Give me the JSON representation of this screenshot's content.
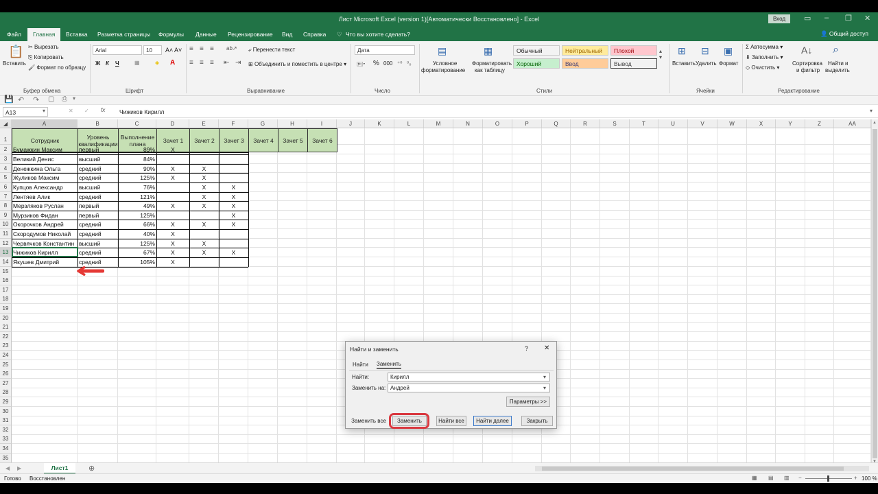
{
  "window": {
    "title": "Лист Microsoft Excel (version 1)[Автоматически Восстановлено]  -  Excel",
    "login_label": "Вход"
  },
  "ribbon_tabs": [
    "Файл",
    "Главная",
    "Вставка",
    "Разметка страницы",
    "Формулы",
    "Данные",
    "Рецензирование",
    "Вид",
    "Справка",
    "Что вы хотите сделать?"
  ],
  "share_label": "Общий доступ",
  "ribbon": {
    "paste": "Вставить",
    "cut": "Вырезать",
    "copy": "Копировать",
    "format_painter": "Формат по образцу",
    "clipboard": "Буфер обмена",
    "font_name": "Arial",
    "font_size": "10",
    "bold": "Ж",
    "italic": "К",
    "underline": "Ч",
    "font_group": "Шрифт",
    "wrap_text": "Перенести текст",
    "merge_center": "Объединить и поместить в центре",
    "alignment_group": "Выравнивание",
    "number_format": "Дата",
    "number_group": "Число",
    "percent": "%",
    "thousands": "000",
    "conditional_1": "Условное",
    "conditional_2": "форматирование",
    "format_table_1": "Форматировать",
    "format_table_2": "как таблицу",
    "styles": [
      {
        "label": "Обычный",
        "bg": "#ffffff",
        "fg": "#111111"
      },
      {
        "label": "Нейтральный",
        "bg": "#ffeb9c",
        "fg": "#9c6500"
      },
      {
        "label": "Плохой",
        "bg": "#ffc7ce",
        "fg": "#9c0006"
      },
      {
        "label": "Хороший",
        "bg": "#c6efce",
        "fg": "#006100"
      },
      {
        "label": "Ввод",
        "bg": "#ffcc99",
        "fg": "#3f3f76"
      },
      {
        "label": "Вывод",
        "bg": "#f2f2f2",
        "fg": "#3f3f3f"
      }
    ],
    "styles_group": "Стили",
    "insert": "Вставить",
    "delete": "Удалить",
    "format": "Формат",
    "cells_group": "Ячейки",
    "autosum": "Автосумма",
    "fill": "Заполнить",
    "clear": "Очистить",
    "sort_1": "Сортировка",
    "sort_2": "и фильтр",
    "find_1": "Найти и",
    "find_2": "выделить",
    "editing_group": "Редактирование"
  },
  "formula_bar": {
    "cell_ref": "A13",
    "content": "Чижиков Кирилл",
    "fx": "fx",
    "cancel": "✕",
    "enter": "✓"
  },
  "columns": [
    "A",
    "B",
    "C",
    "D",
    "E",
    "F",
    "G",
    "H",
    "I",
    "J",
    "K",
    "L",
    "M",
    "N",
    "O",
    "P",
    "Q",
    "R",
    "S",
    "T",
    "U",
    "V",
    "W",
    "X",
    "Y",
    "Z",
    "AA"
  ],
  "row_numbers": [
    "1",
    "2",
    "3",
    "4",
    "5",
    "6",
    "7",
    "8",
    "9",
    "10",
    "11",
    "12",
    "13",
    "14",
    "15",
    "16",
    "17",
    "18",
    "19",
    "20",
    "21",
    "22",
    "23",
    "24",
    "25",
    "26",
    "27",
    "28",
    "29",
    "30",
    "31",
    "32",
    "33",
    "34",
    "35",
    "36"
  ],
  "table_headers": [
    "Сотрудник",
    "Уровень квалификации",
    "Выполнение плана",
    "Зачет 1",
    "Зачет 2",
    "Зачет 3",
    "Зачет 4",
    "Зачет 5",
    "Зачет 6"
  ],
  "table_rows": [
    [
      "Бумажкин Максим",
      "первый",
      "89%",
      "X",
      "",
      ""
    ],
    [
      "Великий Денис",
      "высший",
      "84%",
      "",
      "",
      ""
    ],
    [
      "Денежкина Ольга",
      "средний",
      "90%",
      "X",
      "X",
      ""
    ],
    [
      "Жуликов Максим",
      "средний",
      "125%",
      "X",
      "X",
      ""
    ],
    [
      "Купцов Александр",
      "высший",
      "76%",
      "",
      "X",
      "X"
    ],
    [
      "Лентяев Алик",
      "средний",
      "121%",
      "",
      "X",
      "X"
    ],
    [
      "Мерзляков Руслан",
      "первый",
      "49%",
      "X",
      "X",
      "X"
    ],
    [
      "Мурзиков Фидан",
      "первый",
      "125%",
      "",
      "",
      "X"
    ],
    [
      "Окорочков Андрей",
      "средний",
      "66%",
      "X",
      "X",
      "X"
    ],
    [
      "Скородумов Николай",
      "средний",
      "40%",
      "X",
      "",
      ""
    ],
    [
      "Червячков Константин",
      "высший",
      "125%",
      "X",
      "X",
      ""
    ],
    [
      "Чижиков Кирилл",
      "средний",
      "67%",
      "X",
      "X",
      "X"
    ],
    [
      "Якушев Дмитрий",
      "средний",
      "105%",
      "X",
      "",
      ""
    ]
  ],
  "dialog": {
    "title": "Найти и заменить",
    "help": "?",
    "close": "✕",
    "tab_find": "Найти",
    "tab_replace": "Заменить",
    "find_label": "Найти:",
    "find_value": "Кирилл",
    "replace_label": "Заменить на:",
    "replace_value": "Андрей",
    "options": "Параметры >>",
    "replace_all": "Заменить все",
    "replace": "Заменить",
    "find_all": "Найти все",
    "find_next": "Найти далее",
    "close_btn": "Закрыть"
  },
  "sheet_tab": "Лист1",
  "status": {
    "ready": "Готово",
    "recovered": "Восстановлен",
    "zoom": "100 %"
  }
}
